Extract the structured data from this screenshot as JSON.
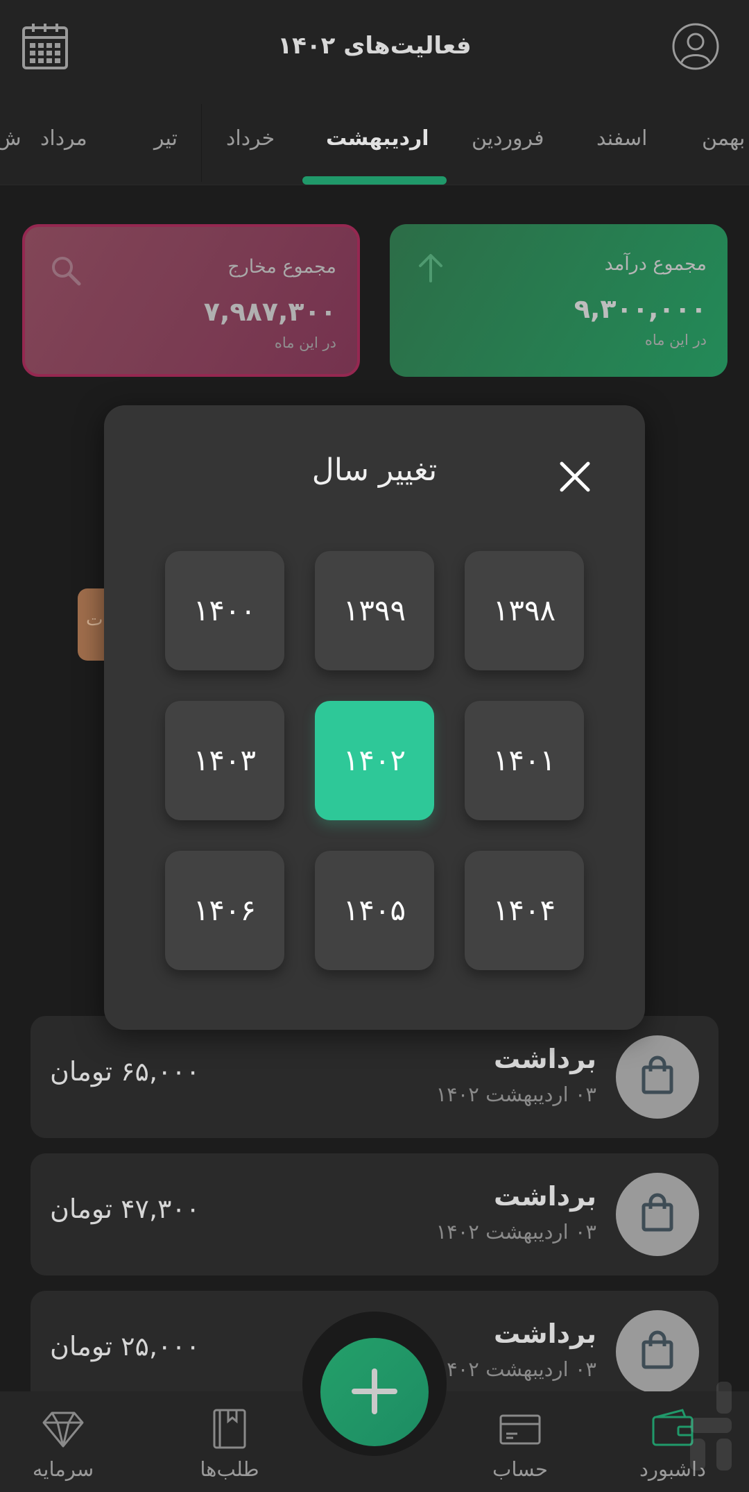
{
  "header": {
    "title": "فعالیت‌های ۱۴۰۲",
    "calendar_icon": "calendar-icon",
    "profile_icon": "user-icon"
  },
  "month_tabs": [
    {
      "label": "بهمن"
    },
    {
      "label": "اسفند"
    },
    {
      "label": "فروردین"
    },
    {
      "label": "اردیبهشت",
      "active": true
    },
    {
      "label": "خرداد"
    },
    {
      "label": "تیر"
    },
    {
      "label": "مرداد"
    },
    {
      "label": "ش"
    }
  ],
  "summary": {
    "income": {
      "title": "مجموع درآمد",
      "amount": "۹,۳۰۰,۰۰۰",
      "sub": "در این ماه",
      "icon": "arrow-up-icon"
    },
    "expense": {
      "title": "مجموع مخارج",
      "amount": "۷,۹۸۷,۳۰۰",
      "sub": "در این ماه",
      "icon": "search-icon"
    }
  },
  "side_tag_text": "ت",
  "modal": {
    "title": "تغییر سال",
    "close_icon": "close-icon",
    "years": [
      "۱۴۰۰",
      "۱۳۹۹",
      "۱۳۹۸",
      "۱۴۰۳",
      "۱۴۰۲",
      "۱۴۰۱",
      "۱۴۰۶",
      "۱۴۰۵",
      "۱۴۰۴"
    ],
    "selected": "۱۴۰۲"
  },
  "transactions": [
    {
      "title": "برداشت",
      "date": "۰۳ اردیبهشت ۱۴۰۲",
      "amount": "۶۵,۰۰۰ تومان",
      "icon": "shopping-bag-icon"
    },
    {
      "title": "برداشت",
      "date": "۰۳ اردیبهشت ۱۴۰۲",
      "amount": "۴۷,۳۰۰ تومان",
      "icon": "shopping-bag-icon"
    },
    {
      "title": "برداشت",
      "date": "۰۳ اردیبهشت ۱۴۰۲",
      "amount": "۲۵,۰۰۰ تومان",
      "icon": "shopping-bag-icon"
    }
  ],
  "bottom_nav": [
    {
      "label": "سرمایه",
      "icon": "diamond-icon"
    },
    {
      "label": "طلب‌ها",
      "icon": "book-icon"
    },
    {
      "label": "حساب",
      "icon": "card-icon"
    },
    {
      "label": "داشبورد",
      "icon": "wallet-icon",
      "active": true
    }
  ],
  "colors": {
    "accent": "#2ec898",
    "income": "#238a58",
    "expense": "#8b4a5c",
    "background": "#1c1c1c"
  }
}
